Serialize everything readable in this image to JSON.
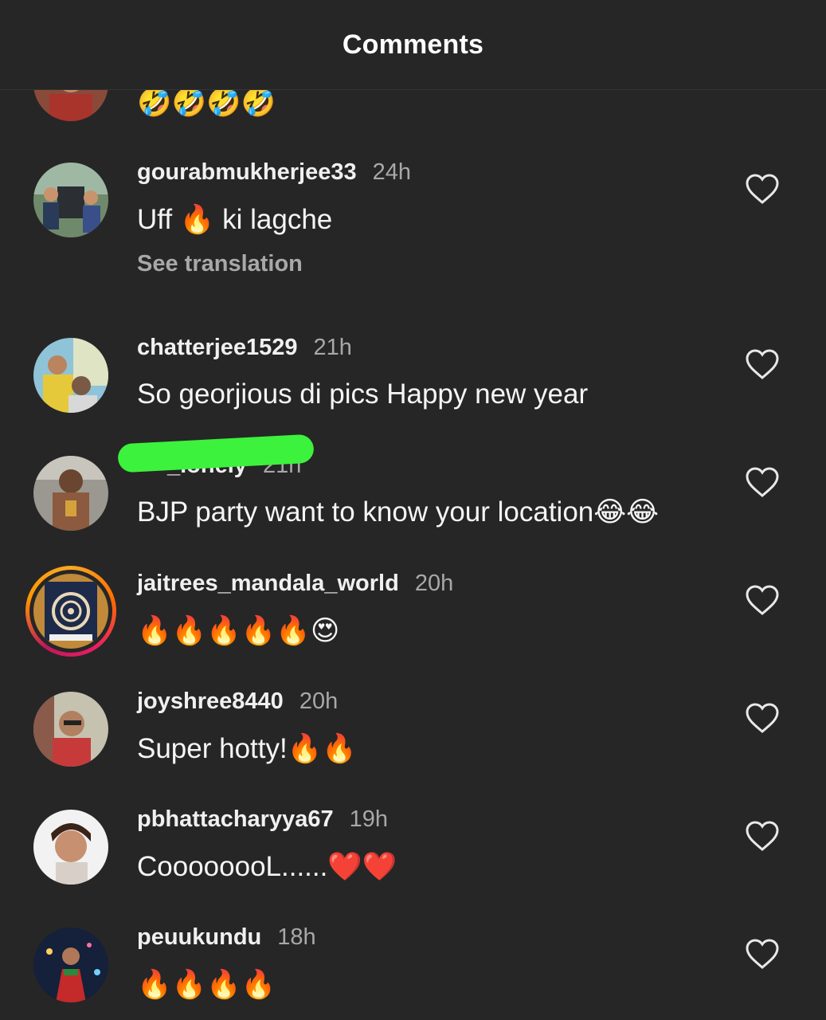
{
  "header": {
    "title": "Comments"
  },
  "top_partial": {
    "text": "🤣🤣🤣🤣"
  },
  "comments": [
    {
      "username": "gourabmukherjee33",
      "time": "24h",
      "text": "Uff 🔥 ki lagche",
      "see_translation": "See translation"
    },
    {
      "username": "chatterjee1529",
      "time": "21h",
      "text": "So georjious di pics Happy  new year"
    },
    {
      "username": "_lonely",
      "time": "21h",
      "text": "BJP party want to know your location😂😂"
    },
    {
      "username": "jaitrees_mandala_world",
      "time": "20h",
      "text": "🔥🔥🔥🔥🔥😍"
    },
    {
      "username": "joyshree8440",
      "time": "20h",
      "text": "Super hotty!🔥🔥"
    },
    {
      "username": "pbhattacharyya67",
      "time": "19h",
      "text": "CoooooooL......❤️❤️"
    },
    {
      "username": "peuukundu",
      "time": "18h",
      "text": "🔥🔥🔥🔥"
    }
  ],
  "icons": {
    "like": "heart-outline-icon"
  },
  "colors": {
    "background": "#262626",
    "text": "#f5f5f5",
    "secondary": "#a8a8a8",
    "redaction": "#3cf23c"
  }
}
